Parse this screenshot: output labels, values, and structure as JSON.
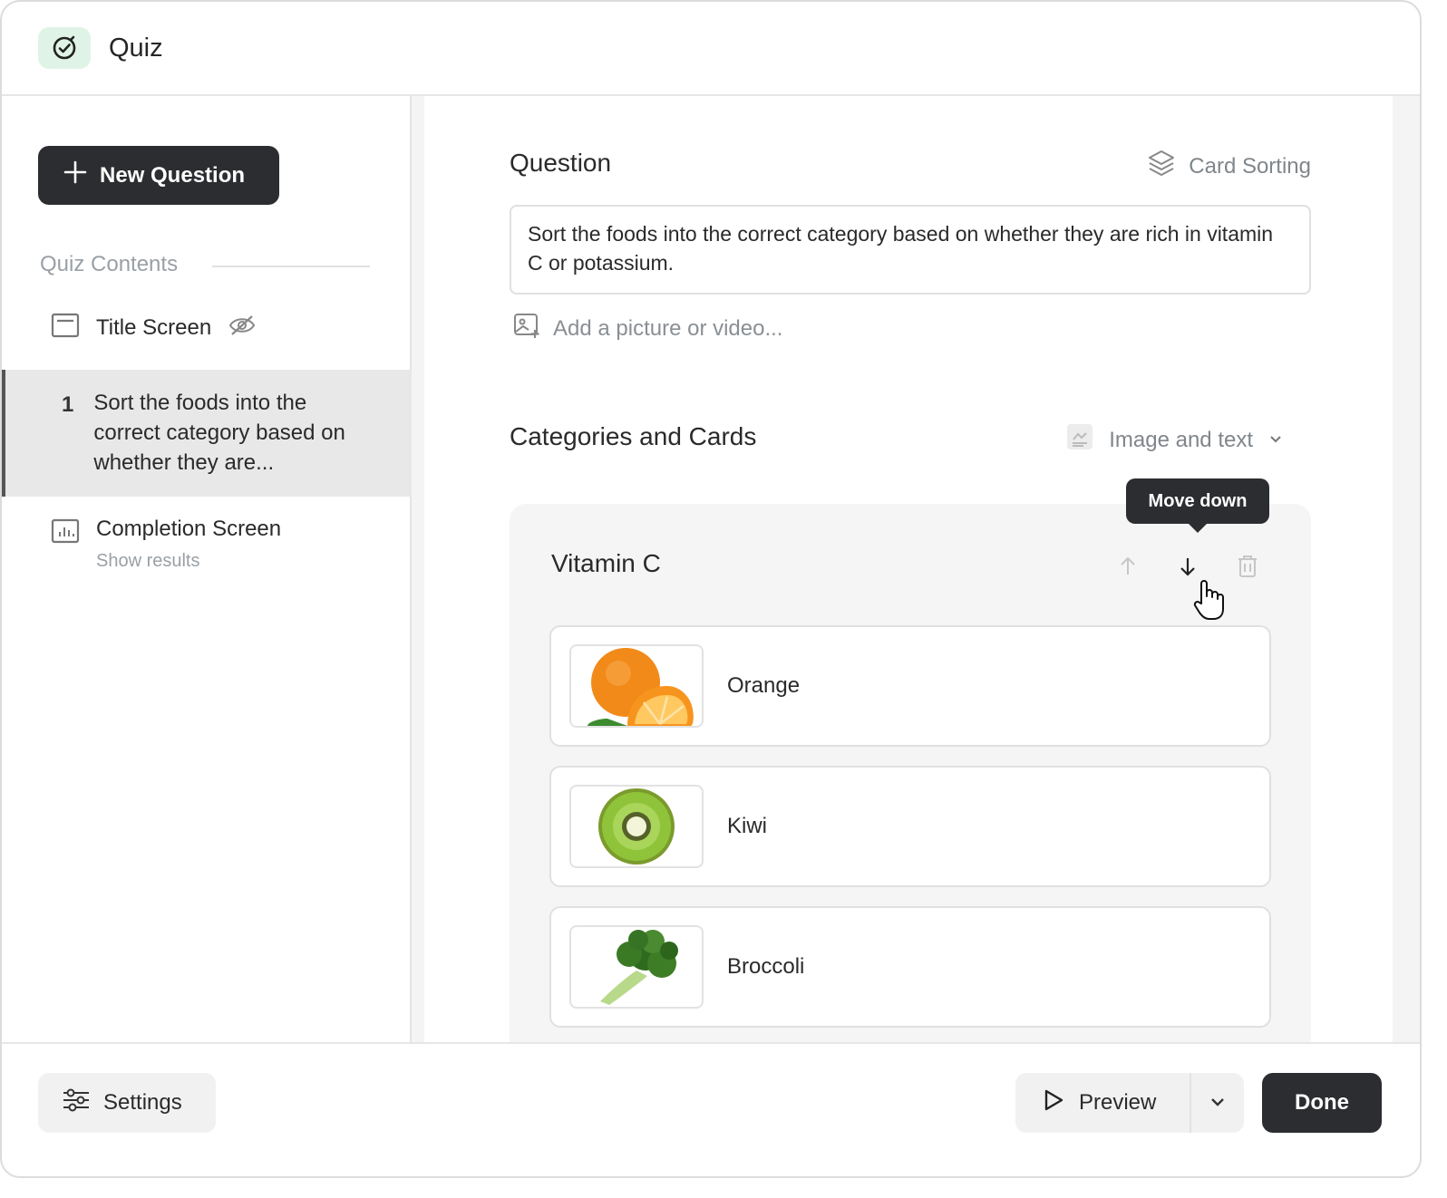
{
  "app": {
    "title": "Quiz",
    "icon": "check-circle-icon"
  },
  "sidebar": {
    "new_question_label": "New Question",
    "contents_label": "Quiz Contents",
    "items": [
      {
        "label": "Title Screen",
        "icon": "screen-icon",
        "status_icon": "eye-off-icon"
      },
      {
        "number": "1",
        "label": "Sort the foods into the correct category based on whether they are..."
      },
      {
        "label": "Completion Screen",
        "sublabel": "Show results",
        "icon": "chart-icon"
      }
    ]
  },
  "main": {
    "question_title": "Question",
    "question_type": "Card Sorting",
    "question_text": "Sort the foods into the correct category based on whether they are rich in vitamin C or potassium.",
    "add_media_label": "Add a picture or video...",
    "categories_title": "Categories and Cards",
    "card_format": "Image and text",
    "category": {
      "name": "Vitamin C",
      "tooltip": "Move down",
      "cards": [
        {
          "label": "Orange",
          "image": "orange-image"
        },
        {
          "label": "Kiwi",
          "image": "kiwi-image"
        },
        {
          "label": "Broccoli",
          "image": "broccoli-image"
        }
      ]
    }
  },
  "footer": {
    "settings_label": "Settings",
    "preview_label": "Preview",
    "done_label": "Done"
  }
}
